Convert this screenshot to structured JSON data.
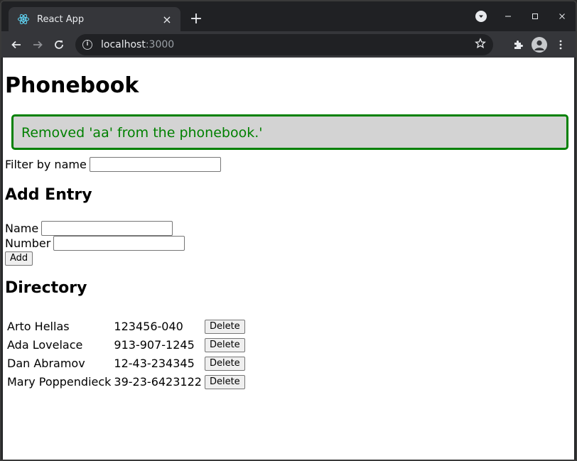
{
  "browser": {
    "tab_title": "React App",
    "tab_close": "×",
    "new_tab": "+",
    "url_host": "localhost",
    "url_port": ":3000"
  },
  "page": {
    "title": "Phonebook",
    "notification": "Removed 'aa' from the phonebook.'",
    "filter_label": "Filter by name",
    "filter_value": "",
    "add_heading": "Add Entry",
    "name_label": "Name",
    "name_value": "",
    "number_label": "Number",
    "number_value": "",
    "add_button": "Add",
    "directory_heading": "Directory",
    "entries": [
      {
        "name": "Arto Hellas",
        "number": "123456-040",
        "delete_label": "Delete"
      },
      {
        "name": "Ada Lovelace",
        "number": "913-907-1245",
        "delete_label": "Delete"
      },
      {
        "name": "Dan Abramov",
        "number": "12-43-234345",
        "delete_label": "Delete"
      },
      {
        "name": "Mary Poppendieck",
        "number": "39-23-6423122",
        "delete_label": "Delete"
      }
    ]
  },
  "colors": {
    "notification_border": "#008000",
    "notification_bg": "#d3d3d3",
    "chrome_dark": "#202124",
    "chrome_tab": "#35363a"
  }
}
